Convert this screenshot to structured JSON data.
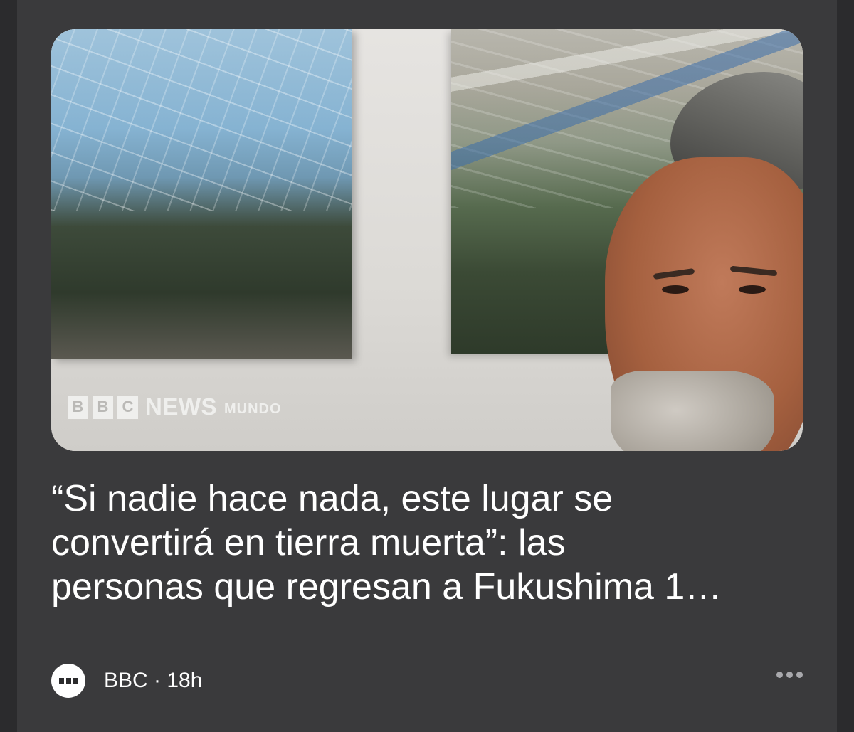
{
  "hero": {
    "logo": {
      "letters": [
        "B",
        "B",
        "C"
      ],
      "news": "NEWS",
      "sub": "MUNDO"
    }
  },
  "headline": "“Si nadie hace nada, este lugar se\nconvertirá en tierra muerta”: las\npersonas que regresan a Fukushima 1…",
  "meta": {
    "source": "BBC",
    "separator": "·",
    "time": "18h",
    "avatar_icon": "bbc-avatar-icon",
    "more_icon": "more-options-icon"
  }
}
